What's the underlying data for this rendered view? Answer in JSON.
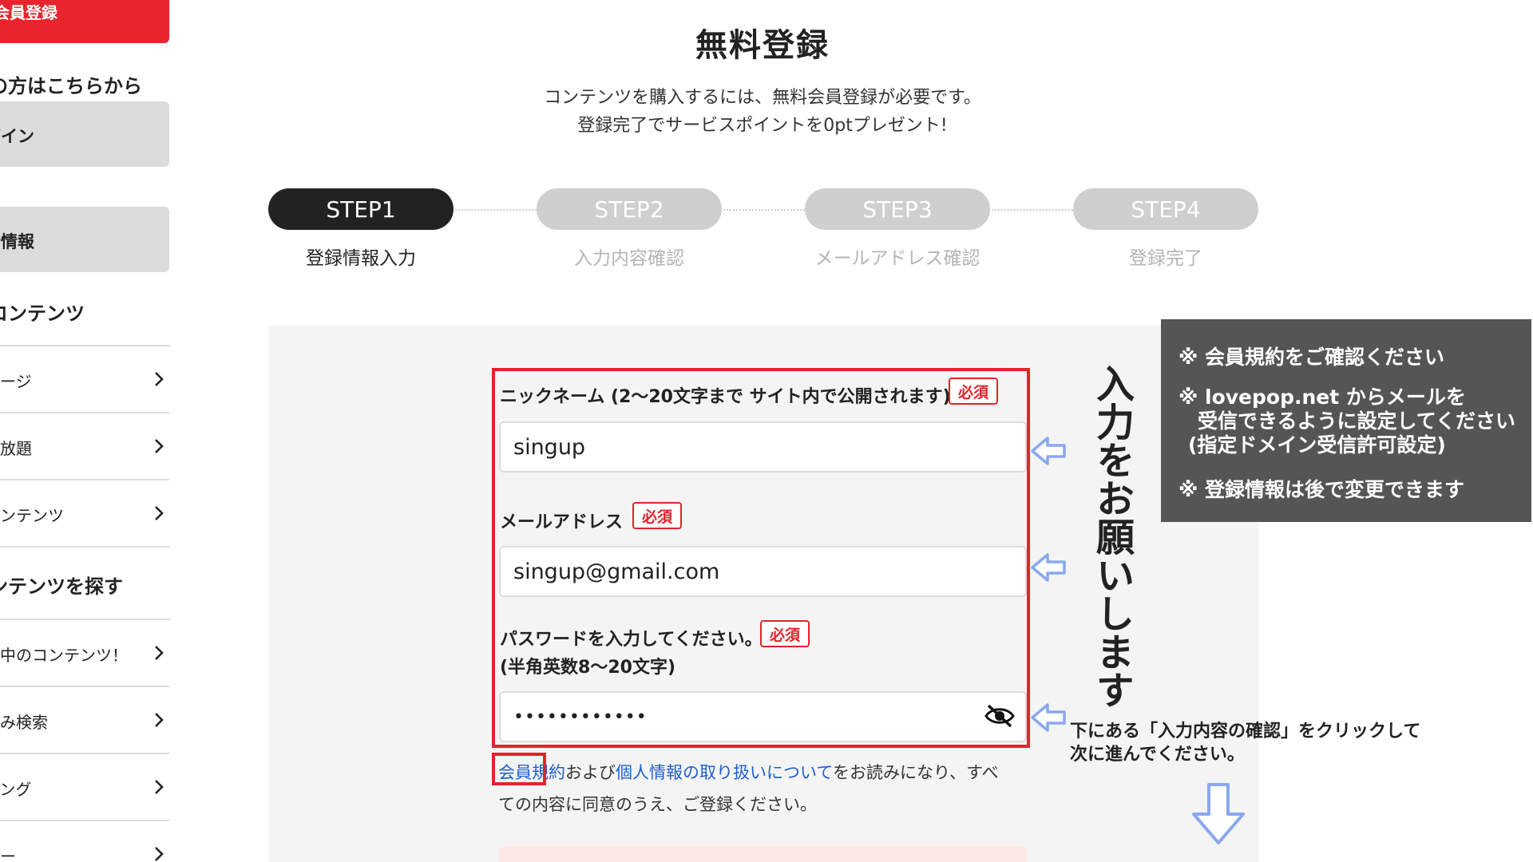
{
  "sidebar": {
    "register_btn": "料会員登録",
    "login_heading": "の方はこちらから",
    "login_btn": "グイン",
    "news_btn": "新情報",
    "contents_heading": "コンテンツ",
    "contents_items": [
      {
        "label": "ページ"
      },
      {
        "label": "見放題"
      },
      {
        "label": "コンテンツ"
      }
    ],
    "search_heading": "ンテンツを探す",
    "search_items": [
      {
        "label": "ル中のコンテンツ！"
      },
      {
        "label": "込み検索"
      },
      {
        "label": "キング"
      },
      {
        "label": "ュー"
      }
    ]
  },
  "header": {
    "title": "無料登録",
    "intro_line1": "コンテンツを購入するには、無料会員登録が必要です。",
    "intro_line2": "登録完了でサービスポイントを0ptプレゼント!"
  },
  "steps": [
    {
      "name": "STEP1",
      "label": "登録情報入力",
      "active": true
    },
    {
      "name": "STEP2",
      "label": "入力内容確認",
      "active": false
    },
    {
      "name": "STEP3",
      "label": "メールアドレス確認",
      "active": false
    },
    {
      "name": "STEP4",
      "label": "登録完了",
      "active": false
    }
  ],
  "form": {
    "nickname_label": "ニックネーム (2〜20文字まで サイト内で公開されます)",
    "nickname_value": "singup",
    "email_label": "メールアドレス",
    "email_value": "singup@gmail.com",
    "password_label_line1": "パスワードを入力してください。",
    "password_label_line2": "(半角英数8〜20文字)",
    "password_value": "••••••••••••",
    "required_badge": "必須",
    "terms_link": "会員規約",
    "terms_mid": "および",
    "privacy_link": "個人情報の取り扱いについて",
    "terms_after": "をお読みになり、すべ",
    "terms_line2": "ての内容に同意のうえ、ご登録ください。"
  },
  "annotations": {
    "vertical_text": "入力をお願いします",
    "note_line1": "※ 会員規約をご確認ください",
    "note_line2": "※ lovepop.net からメールを",
    "note_line3": "受信できるように設定してください",
    "note_line4": "(指定ドメイン受信許可設定)",
    "note_line5": "※ 登録情報は後で変更できます",
    "guide_line1": "下にある「入力内容の確認」をクリックして",
    "guide_line2": "次に進んでください。"
  },
  "colors": {
    "brand_red": "#e8242c",
    "link_blue": "#1f5fcf",
    "step_active": "#222222",
    "step_inactive": "#cfcfcf",
    "arrow_blue": "#8aa8f0",
    "note_bg": "#555555"
  },
  "icons": {
    "chevron": "chevron-right-icon",
    "eye": "eye-off-icon",
    "arrow_left": "arrow-left-outline-icon",
    "arrow_down": "arrow-down-outline-icon"
  }
}
